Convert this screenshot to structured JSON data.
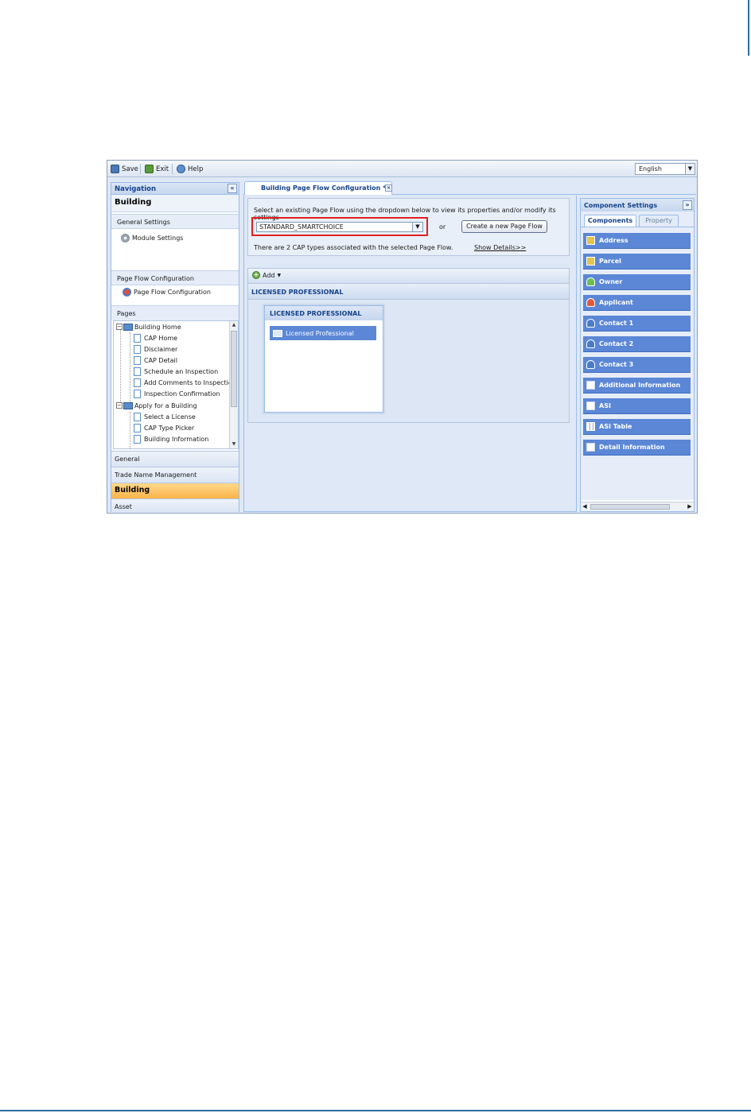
{
  "toolbar": {
    "save_label": "Save",
    "exit_label": "Exit",
    "help_label": "Help",
    "language": "English"
  },
  "navigation": {
    "header": "Navigation",
    "module_title": "Building",
    "sections": {
      "general_settings": "General Settings",
      "module_settings": "Module Settings",
      "page_flow_configuration": "Page Flow Configuration",
      "page_flow_configuration_item": "Page Flow Configuration",
      "pages": "Pages"
    },
    "tree": [
      {
        "label": "Building Home",
        "type": "folder"
      },
      {
        "label": "CAP Home",
        "type": "page"
      },
      {
        "label": "Disclaimer",
        "type": "page"
      },
      {
        "label": "CAP Detail",
        "type": "page"
      },
      {
        "label": "Schedule an Inspection",
        "type": "page"
      },
      {
        "label": "Add Comments to Inspection",
        "type": "page"
      },
      {
        "label": "Inspection Confirmation",
        "type": "page"
      },
      {
        "label": "Apply for a Building",
        "type": "folder"
      },
      {
        "label": "Select a License",
        "type": "page"
      },
      {
        "label": "CAP Type Picker",
        "type": "page"
      },
      {
        "label": "Building Information",
        "type": "page"
      }
    ],
    "accordion": [
      {
        "label": "General",
        "active": false
      },
      {
        "label": "Trade Name Management",
        "active": false
      },
      {
        "label": "Building",
        "active": true
      },
      {
        "label": "Asset",
        "active": false
      }
    ]
  },
  "main": {
    "tab_title": "Building Page Flow Configuration *",
    "instruction": "Select an existing Page Flow using the dropdown below to view its properties and/or modify its settings",
    "selected_page_flow": "STANDARD_SMARTCHOICE",
    "or_text": "or",
    "create_button": "Create a new Page Flow",
    "cap_types_text": "There are 2 CAP types associated with the selected Page Flow.",
    "show_details": "Show Details>>",
    "add_label": "Add",
    "step_bar_title": "LICENSED PROFESSIONAL",
    "step_card_title": "LICENSED PROFESSIONAL",
    "step_component": "Licensed Professional"
  },
  "component_settings": {
    "header": "Component Settings",
    "tabs": [
      "Components",
      "Property"
    ],
    "active_tab": "Components",
    "items": [
      {
        "label": "Address",
        "icon": "address-icon"
      },
      {
        "label": "Parcel",
        "icon": "parcel-icon"
      },
      {
        "label": "Owner",
        "icon": "owner-icon"
      },
      {
        "label": "Applicant",
        "icon": "applicant-icon"
      },
      {
        "label": "Contact 1",
        "icon": "contact-icon"
      },
      {
        "label": "Contact 2",
        "icon": "contact-icon"
      },
      {
        "label": "Contact 3",
        "icon": "contact-icon"
      },
      {
        "label": "Additional Information",
        "icon": "document-icon"
      },
      {
        "label": "ASI",
        "icon": "asi-icon"
      },
      {
        "label": "ASI Table",
        "icon": "table-icon"
      },
      {
        "label": "Detail Information",
        "icon": "document-icon"
      }
    ]
  },
  "colors": {
    "accent_blue": "#5b87d6",
    "header_text": "#15428b",
    "active_accordion": "#f9b449",
    "highlight_border": "#e02020"
  }
}
